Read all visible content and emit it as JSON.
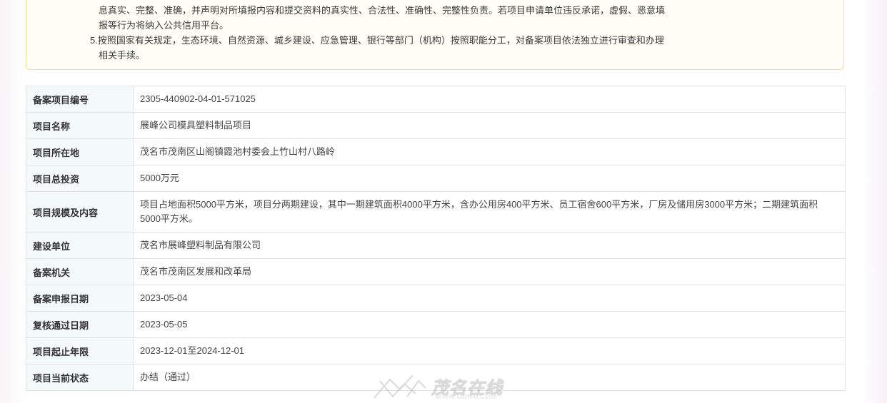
{
  "notice": {
    "line1": "息真实、完整、准确，并声明对所填报内容和提交资料的真实性、合法性、准确性、完整性负责。若项目申请单位违反承诺，虚假、恶意填",
    "line2": "报等行为将纳入公共信用平台。",
    "line3": "5.按照国家有关规定，生态环境、自然资源、城乡建设、应急管理、银行等部门（机构）按照职能分工，对备案项目依法独立进行审查和办理",
    "line4": "相关手续。"
  },
  "table": {
    "rows": [
      {
        "label": "备案项目编号",
        "value": "2305-440902-04-01-571025"
      },
      {
        "label": "项目名称",
        "value": "展峰公司模具塑料制品项目"
      },
      {
        "label": "项目所在地",
        "value": "茂名市茂南区山阁镇霞池村委会上竹山村八路岭"
      },
      {
        "label": "项目总投资",
        "value": "5000万元"
      },
      {
        "label": "项目规模及内容",
        "value": "项目占地面积5000平方米，项目分两期建设，其中一期建筑面积4000平方米，含办公用房400平方米、员工宿舍600平方米，厂房及储用房3000平方米；二期建筑面积5000平方米。"
      },
      {
        "label": "建设单位",
        "value": "茂名市展峰塑料制品有限公司"
      },
      {
        "label": "备案机关",
        "value": "茂名市茂南区发展和改革局"
      },
      {
        "label": "备案申报日期",
        "value": "2023-05-04"
      },
      {
        "label": "复核通过日期",
        "value": "2023-05-05"
      },
      {
        "label": "项目起止年限",
        "value": "2023-12-01至2024-12-01"
      },
      {
        "label": "项目当前状态",
        "value": "办结（通过）"
      }
    ]
  },
  "watermark": {
    "name": "茂名在线",
    "url": "WWW.GDMM.COM"
  }
}
